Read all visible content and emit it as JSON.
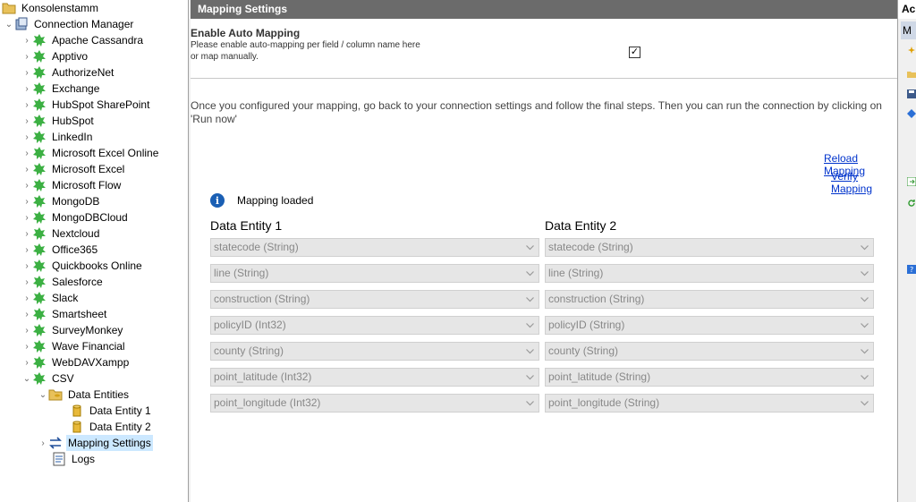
{
  "tree": {
    "root": "Konsolenstamm",
    "connection_manager": "Connection Manager",
    "connectors": [
      "Apache Cassandra",
      "Apptivo",
      "AuthorizeNet",
      "Exchange",
      "HubSpot SharePoint",
      "HubSpot",
      "LinkedIn",
      "Microsoft Excel Online",
      "Microsoft Excel",
      "Microsoft Flow",
      "MongoDB",
      "MongoDBCloud",
      "Nextcloud",
      "Office365",
      "Quickbooks Online",
      "Salesforce",
      "Slack",
      "Smartsheet",
      "SurveyMonkey",
      "Wave Financial",
      "WebDAVXampp"
    ],
    "csv": "CSV",
    "data_entities": "Data Entities",
    "entity1": "Data Entity 1",
    "entity2": "Data Entity 2",
    "mapping_settings": "Mapping Settings",
    "logs": "Logs"
  },
  "main": {
    "header": "Mapping Settings",
    "automap_title": "Enable Auto Mapping",
    "automap_desc": "Please enable auto-mapping per field / column name here or map manually.",
    "automap_checked": "✓",
    "info": "Once you configured your mapping, go back to your connection settings and follow the final steps. Then you can run the connection by clicking on 'Run now'",
    "reload_link": "Reload Mapping",
    "verify_link": "Verify Mapping",
    "status_text": "Mapping loaded",
    "col1_header": "Data Entity 1",
    "col2_header": "Data Entity 2",
    "col1_fields": [
      "statecode (String)",
      "line (String)",
      "construction (String)",
      "policyID (Int32)",
      "county (String)",
      "point_latitude (Int32)",
      "point_longitude (Int32)"
    ],
    "col2_fields": [
      "statecode (String)",
      "line (String)",
      "construction (String)",
      "policyID (String)",
      "county (String)",
      "point_latitude (String)",
      "point_longitude (String)"
    ]
  },
  "right_panel": {
    "header": "Ac",
    "tab": "M"
  },
  "colors": {
    "header_bg": "#6b6b6b",
    "connector_icon": "#3cb043",
    "link": "#0033cc",
    "selection": "#cce8ff"
  }
}
